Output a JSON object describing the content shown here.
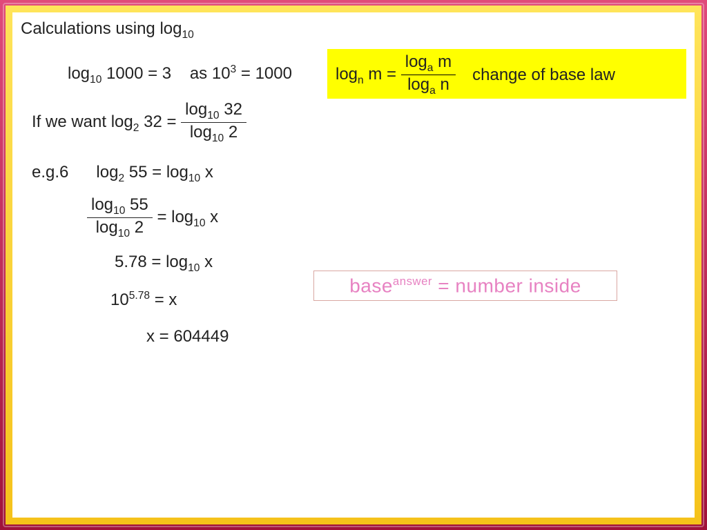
{
  "title_prefix": "Calculations using log",
  "title_sub": "10",
  "line1_a": "log",
  "line1_a_sub": "10",
  "line1_a_tail": " 1000 = 3",
  "line1_b": "as 10",
  "line1_b_sup": "3",
  "line1_b_tail": " = 1000",
  "line2_lead": "If we want log",
  "line2_sub": "2",
  "line2_mid": " 32 = ",
  "line2_frac_num_a": "log",
  "line2_frac_num_sub": "10",
  "line2_frac_num_b": " 32",
  "line2_frac_den_a": "log",
  "line2_frac_den_sub": "10",
  "line2_frac_den_b": " 2",
  "line3_lead": "e.g.6",
  "line3_a": "log",
  "line3_a_sub": "2",
  "line3_a_mid": " 55 = log",
  "line3_a_sub2": "10",
  "line3_a_tail": " x",
  "line4_frac_num_a": "log",
  "line4_frac_num_sub": "10",
  "line4_frac_num_b": " 55",
  "line4_frac_den_a": "log",
  "line4_frac_den_sub": "10",
  "line4_frac_den_b": " 2",
  "line4_tail_a": " = log",
  "line4_tail_sub": "10",
  "line4_tail_b": " x",
  "line5_a": "5.78  = log",
  "line5_sub": "10",
  "line5_b": " x",
  "line6_a": "10",
  "line6_sup": "5.78",
  "line6_b": " = x",
  "line7": "x = 604449",
  "yellow_a": "log",
  "yellow_a_sub": "n",
  "yellow_a_mid": " m = ",
  "yellow_frac_num_a": "log",
  "yellow_frac_num_sub": "a",
  "yellow_frac_num_b": " m",
  "yellow_frac_den_a": "log",
  "yellow_frac_den_sub": "a",
  "yellow_frac_den_b": " n",
  "yellow_label": "change of base law",
  "pink_a": "base",
  "pink_sup": "answer",
  "pink_b": " = number inside"
}
